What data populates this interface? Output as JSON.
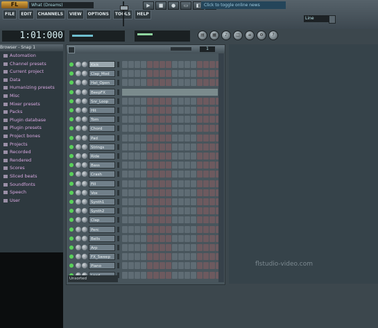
{
  "app": {
    "logo": "FL",
    "song_title": "What (Dreams)"
  },
  "menu": [
    "FILE",
    "EDIT",
    "CHANNELS",
    "VIEW",
    "OPTIONS",
    "TOOLS",
    "HELP"
  ],
  "hint_bar": "Click to toggle online news",
  "pattern_box": "Line",
  "time_display": "1:01:000",
  "transport": [
    "▶",
    "■",
    "●",
    "▭",
    "◧",
    "≡"
  ],
  "browser": {
    "header": "Browser - Snap 1",
    "folders": [
      "Automation",
      "Channel presets",
      "Current project",
      "Data",
      "Humanizing presets",
      "Misc",
      "Mixer presets",
      "Packs",
      "Plugin database",
      "Plugin presets",
      "Project bones",
      "Projects",
      "Recorded",
      "Rendered",
      "Scores",
      "Sliced beats",
      "Soundfonts",
      "Speech",
      "User"
    ]
  },
  "sequencer": {
    "pattern_num": "1",
    "bottom_label": "Unsorted",
    "channels": [
      {
        "name": "Kick"
      },
      {
        "name": "Clap_Mod"
      },
      {
        "name": "Hat_Open"
      },
      {
        "name": "BeepFX",
        "pianoroll": true
      },
      {
        "name": "Snr_Loop"
      },
      {
        "name": "Hit"
      },
      {
        "name": "Tom"
      },
      {
        "name": "Chord"
      },
      {
        "name": "Pad"
      },
      {
        "name": "Strings"
      },
      {
        "name": "Ride"
      },
      {
        "name": "Bass"
      },
      {
        "name": "Crash"
      },
      {
        "name": "Fill"
      },
      {
        "name": "Vox"
      },
      {
        "name": "Synth1"
      },
      {
        "name": "Synth2"
      },
      {
        "name": "Clap"
      },
      {
        "name": "Perc"
      },
      {
        "name": "Bells"
      },
      {
        "name": "Arp"
      },
      {
        "name": "FX_Sweep"
      },
      {
        "name": "Piano"
      },
      {
        "name": "Lead"
      }
    ]
  },
  "watermark": "flstudio-video.com"
}
